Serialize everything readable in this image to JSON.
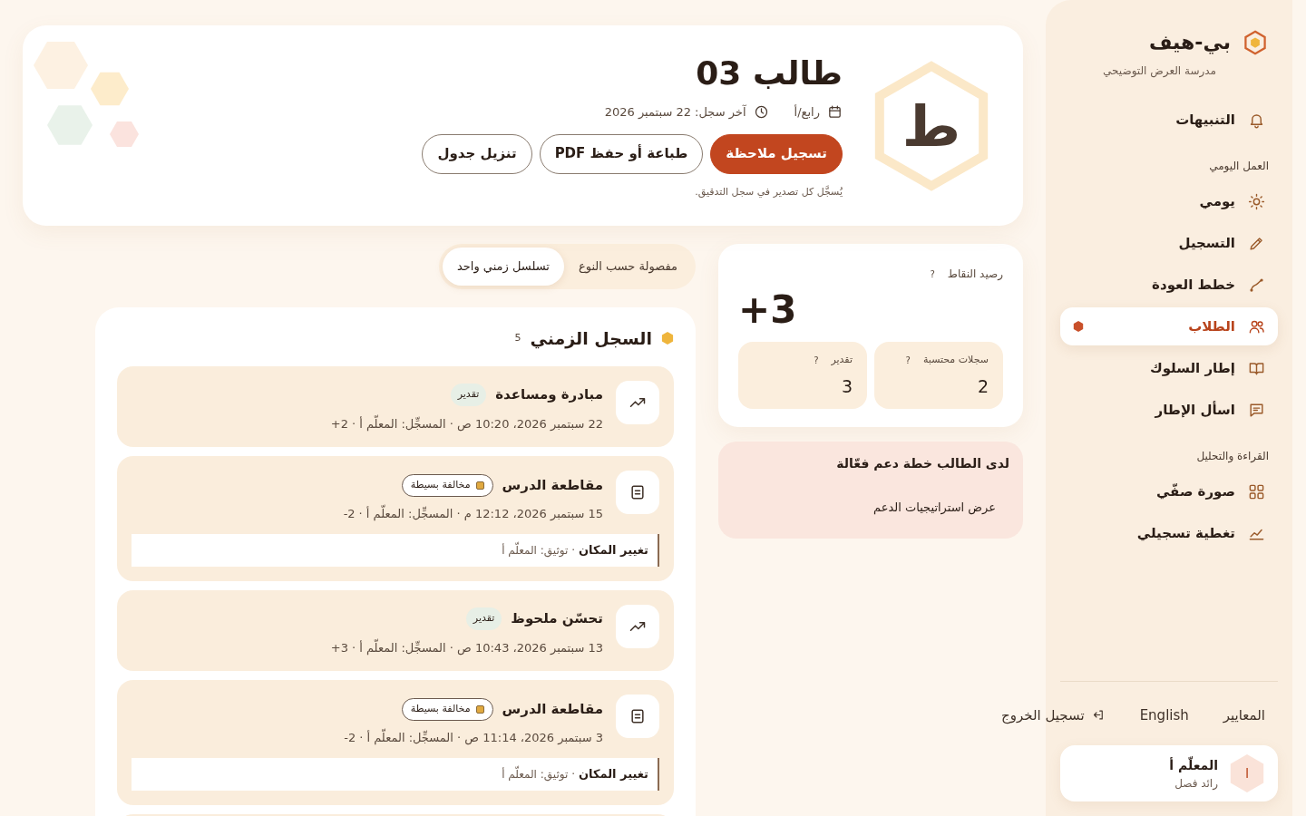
{
  "sidebar": {
    "brand": "بي-هيف",
    "school": "مدرسة العرض التوضيحي",
    "groups": [
      {
        "items": [
          {
            "label": "التنبيهات",
            "selected": false
          }
        ]
      },
      {
        "title": "العمل اليومي",
        "items": [
          {
            "label": "يومي",
            "selected": false
          },
          {
            "label": "التسجيل",
            "selected": false
          },
          {
            "label": "خطط العودة",
            "selected": false
          },
          {
            "label": "الطلاب",
            "selected": true
          },
          {
            "label": "إطار السلوك",
            "selected": false
          },
          {
            "label": "اسأل الإطار",
            "selected": false
          }
        ]
      },
      {
        "title": "القراءة والتحليل",
        "items": [
          {
            "label": "صورة صفّي",
            "selected": false
          },
          {
            "label": "تغطية تسجيلي",
            "selected": false
          }
        ]
      }
    ],
    "footer_links": [
      "المعايير",
      "English",
      "تسجيل الخروج"
    ],
    "user": {
      "initial": "ا",
      "name": "المعلّم أ",
      "role": "رائد فصل"
    }
  },
  "header": {
    "initial": "ط",
    "name": "طالب 03",
    "class": "رابع/أ",
    "last_record": "آخر سجل: 22 سبتمبر 2026",
    "buttons": [
      {
        "label": "تسجيل ملاحظة",
        "kind": "primary"
      },
      {
        "label": "طباعة أو حفظ PDF",
        "kind": "outline"
      },
      {
        "label": "تنزيل جدول",
        "kind": "outline"
      }
    ],
    "note": "يُسجَّل كل تصدير في سجل التدقيق."
  },
  "points": {
    "label": "رصيد النقاط",
    "help": "?",
    "value": "+3",
    "stats": [
      {
        "label": "سجلات محتسبة",
        "help": "?",
        "value": "2"
      },
      {
        "label": "تقدير",
        "help": "?",
        "value": "3"
      }
    ]
  },
  "support": {
    "text": "لدى الطالب خطة دعم فعّالة",
    "link": "عرض استراتيجيات الدعم"
  },
  "view_tabs": [
    {
      "label": "مفصولة حسب النوع",
      "selected": false
    },
    {
      "label": "تسلسل زمني واحد",
      "selected": true
    }
  ],
  "timeline": {
    "title": "السجل الزمني",
    "count": "5",
    "entries": [
      {
        "kind": "rating",
        "title": "مبادرة ومساعدة",
        "tag": "تقدير",
        "meta": "22 سبتمبر 2026، 10:20 ص · المسجِّل: المعلّم أ ·",
        "points": "+2"
      },
      {
        "kind": "incident",
        "title": "مقاطعة الدرس",
        "tag": "مخالفة بسيطة",
        "color": "#e0a940",
        "meta": "15 سبتمبر 2026، 12:12 م · المسجِّل: المعلّم أ ·",
        "points": "-2",
        "note_title": "تغيير المكان",
        "note_detail": "· توثيق: المعلّم أ"
      },
      {
        "kind": "rating",
        "title": "تحسّن ملحوظ",
        "tag": "تقدير",
        "meta": "13 سبتمبر 2026، 10:43 ص · المسجِّل: المعلّم أ ·",
        "points": "+3"
      },
      {
        "kind": "incident",
        "title": "مقاطعة الدرس",
        "tag": "مخالفة بسيطة",
        "color": "#e0a940",
        "meta": "3 سبتمبر 2026، 11:14 ص · المسجِّل: المعلّم أ ·",
        "points": "-2",
        "note_title": "تغيير المكان",
        "note_detail": "· توثيق: المعلّم أ"
      },
      {
        "kind": "hidden"
      }
    ]
  }
}
